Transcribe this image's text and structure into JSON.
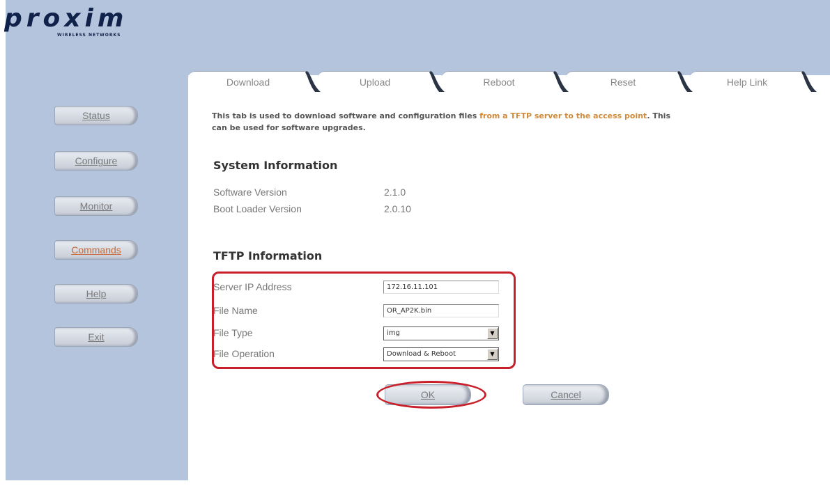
{
  "brand": {
    "logo_text": "proxim",
    "logo_subtitle": "WIRELESS NETWORKS"
  },
  "sidebar": {
    "items": [
      {
        "label": "Status"
      },
      {
        "label": "Configure"
      },
      {
        "label": "Monitor"
      },
      {
        "label": "Commands",
        "active": true
      },
      {
        "label": "Help"
      },
      {
        "label": "Exit"
      }
    ]
  },
  "tabs": [
    {
      "label": "Download",
      "selected": true
    },
    {
      "label": "Upload"
    },
    {
      "label": "Reboot"
    },
    {
      "label": "Reset"
    },
    {
      "label": "Help Link"
    }
  ],
  "intro": {
    "part1": "This tab is used to download software and configuration files ",
    "highlight": "from a TFTP server to the access point",
    "part2": ". This can be used for software upgrades."
  },
  "system_info": {
    "title": "System Information",
    "software_version_label": "Software Version",
    "software_version": "2.1.0",
    "boot_loader_label": "Boot Loader Version",
    "boot_loader_version": "2.0.10"
  },
  "tftp": {
    "title": "TFTP Information",
    "server_ip_label": "Server IP Address",
    "server_ip": "172.16.11.101",
    "file_name_label": "File Name",
    "file_name": "OR_AP2K.bin",
    "file_type_label": "File Type",
    "file_type": "img",
    "file_operation_label": "File Operation",
    "file_operation": "Download & Reboot"
  },
  "buttons": {
    "ok": "OK",
    "cancel": "Cancel"
  },
  "colors": {
    "panel": "#b4c4dd",
    "highlight": "#d08a3a",
    "annotation": "#c8202a",
    "active_link": "#c86a3a"
  }
}
